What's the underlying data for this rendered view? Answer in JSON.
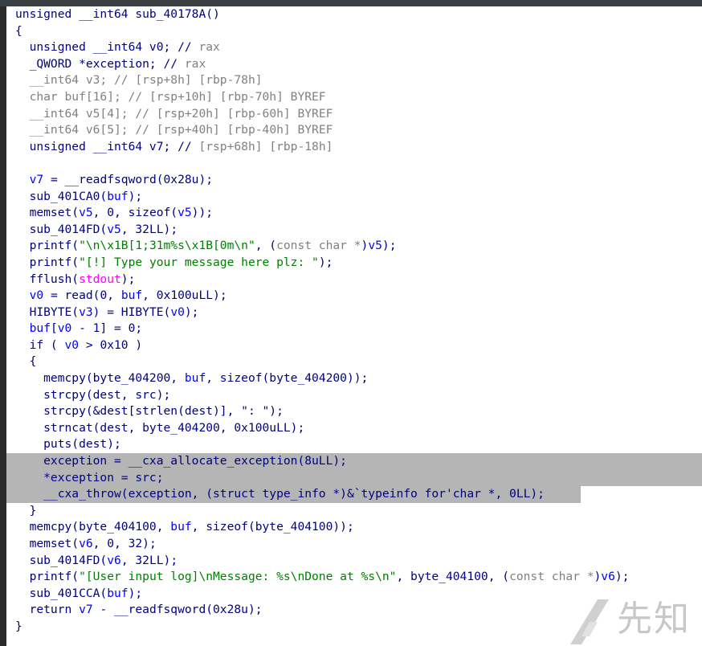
{
  "editor": {
    "lines": [
      {
        "selected": false,
        "tokens": [
          {
            "t": "unsigned __int64 sub_40178A()",
            "c": "plain"
          }
        ]
      },
      {
        "selected": false,
        "tokens": [
          {
            "t": "{",
            "c": "plain"
          }
        ]
      },
      {
        "selected": false,
        "tokens": [
          {
            "t": "  unsigned __int64 v0; // ",
            "c": "plain"
          },
          {
            "t": "rax",
            "c": "cmt"
          }
        ]
      },
      {
        "selected": false,
        "tokens": [
          {
            "t": "  _QWORD *exception; // ",
            "c": "plain"
          },
          {
            "t": "rax",
            "c": "cmt"
          }
        ]
      },
      {
        "selected": false,
        "tokens": [
          {
            "t": "  __int64 v3; // ",
            "c": "cmt"
          },
          {
            "t": "[rsp+8h] [rbp-78h]",
            "c": "cmt"
          }
        ]
      },
      {
        "selected": false,
        "tokens": [
          {
            "t": "  char buf[16]; // ",
            "c": "cmt"
          },
          {
            "t": "[rsp+10h] [rbp-70h] BYREF",
            "c": "cmt"
          }
        ]
      },
      {
        "selected": false,
        "tokens": [
          {
            "t": "  __int64 v5[4]; // ",
            "c": "cmt"
          },
          {
            "t": "[rsp+20h] [rbp-60h] BYREF",
            "c": "cmt"
          }
        ]
      },
      {
        "selected": false,
        "tokens": [
          {
            "t": "  __int64 v6[5]; // ",
            "c": "cmt"
          },
          {
            "t": "[rsp+40h] [rbp-40h] BYREF",
            "c": "cmt"
          }
        ]
      },
      {
        "selected": false,
        "tokens": [
          {
            "t": "  unsigned __int64 v7; // ",
            "c": "plain"
          },
          {
            "t": "[rsp+68h] [rbp-18h]",
            "c": "cmt"
          }
        ]
      },
      {
        "selected": false,
        "tokens": [
          {
            "t": "",
            "c": "plain"
          }
        ]
      },
      {
        "selected": false,
        "tokens": [
          {
            "t": "  v7",
            "c": "var"
          },
          {
            "t": " = __readfsqword(0x28u);",
            "c": "plain"
          }
        ]
      },
      {
        "selected": false,
        "tokens": [
          {
            "t": "  sub_401CA0(",
            "c": "plain"
          },
          {
            "t": "buf",
            "c": "var"
          },
          {
            "t": ");",
            "c": "plain"
          }
        ]
      },
      {
        "selected": false,
        "tokens": [
          {
            "t": "  memset(",
            "c": "plain"
          },
          {
            "t": "v5",
            "c": "var"
          },
          {
            "t": ", 0, sizeof(",
            "c": "plain"
          },
          {
            "t": "v5",
            "c": "var"
          },
          {
            "t": "));",
            "c": "plain"
          }
        ]
      },
      {
        "selected": false,
        "tokens": [
          {
            "t": "  sub_4014FD(",
            "c": "plain"
          },
          {
            "t": "v5",
            "c": "var"
          },
          {
            "t": ", 32LL);",
            "c": "plain"
          }
        ]
      },
      {
        "selected": false,
        "tokens": [
          {
            "t": "  printf(",
            "c": "plain"
          },
          {
            "t": "\"\\n\\x1B[1;31m%s\\x1B[0m\\n\"",
            "c": "str"
          },
          {
            "t": ", (",
            "c": "plain"
          },
          {
            "t": "const char *",
            "c": "cmt"
          },
          {
            "t": ")",
            "c": "plain"
          },
          {
            "t": "v5",
            "c": "var"
          },
          {
            "t": ");",
            "c": "plain"
          }
        ]
      },
      {
        "selected": false,
        "tokens": [
          {
            "t": "  printf(",
            "c": "plain"
          },
          {
            "t": "\"[!] Type your message here plz: \"",
            "c": "str"
          },
          {
            "t": ");",
            "c": "plain"
          }
        ]
      },
      {
        "selected": false,
        "tokens": [
          {
            "t": "  fflush(",
            "c": "plain"
          },
          {
            "t": "stdout",
            "c": "glob"
          },
          {
            "t": ");",
            "c": "plain"
          }
        ]
      },
      {
        "selected": false,
        "tokens": [
          {
            "t": "  v0",
            "c": "var"
          },
          {
            "t": " = read(0, ",
            "c": "plain"
          },
          {
            "t": "buf",
            "c": "var"
          },
          {
            "t": ", 0x100uLL);",
            "c": "plain"
          }
        ]
      },
      {
        "selected": false,
        "tokens": [
          {
            "t": "  HIBYTE(",
            "c": "plain"
          },
          {
            "t": "v3",
            "c": "var"
          },
          {
            "t": ") = HIBYTE(",
            "c": "plain"
          },
          {
            "t": "v0",
            "c": "var"
          },
          {
            "t": ");",
            "c": "plain"
          }
        ]
      },
      {
        "selected": false,
        "tokens": [
          {
            "t": "  buf",
            "c": "var"
          },
          {
            "t": "[",
            "c": "plain"
          },
          {
            "t": "v0",
            "c": "var"
          },
          {
            "t": " - 1] = 0;",
            "c": "plain"
          }
        ]
      },
      {
        "selected": false,
        "tokens": [
          {
            "t": "  if ( ",
            "c": "plain"
          },
          {
            "t": "v0",
            "c": "var"
          },
          {
            "t": " > 0x10 )",
            "c": "plain"
          }
        ]
      },
      {
        "selected": false,
        "tokens": [
          {
            "t": "  {",
            "c": "plain"
          }
        ]
      },
      {
        "selected": false,
        "tokens": [
          {
            "t": "    memcpy(byte_404200, ",
            "c": "plain"
          },
          {
            "t": "buf",
            "c": "var"
          },
          {
            "t": ", sizeof(byte_404200));",
            "c": "plain"
          }
        ]
      },
      {
        "selected": false,
        "tokens": [
          {
            "t": "    strcpy(dest, src);",
            "c": "plain"
          }
        ]
      },
      {
        "selected": false,
        "tokens": [
          {
            "t": "    strcpy(&dest[strlen(dest)], \": \");",
            "c": "plain"
          }
        ]
      },
      {
        "selected": false,
        "tokens": [
          {
            "t": "    strncat(dest, byte_404200, 0x100uLL);",
            "c": "plain"
          }
        ]
      },
      {
        "selected": false,
        "tokens": [
          {
            "t": "    puts(dest);",
            "c": "plain"
          }
        ]
      },
      {
        "selected": "full",
        "tokens": [
          {
            "t": "    exception = __cxa_allocate_exception(8uLL);",
            "c": "plain"
          }
        ]
      },
      {
        "selected": "full",
        "tokens": [
          {
            "t": "    *exception = src;",
            "c": "plain"
          }
        ]
      },
      {
        "selected": "partial",
        "tokens": [
          {
            "t": "    __cxa_throw(exception, (struct type_info *)&`typeinfo for'char *, 0LL);",
            "c": "plain"
          }
        ]
      },
      {
        "selected": false,
        "tokens": [
          {
            "t": "  }",
            "c": "plain"
          }
        ]
      },
      {
        "selected": false,
        "tokens": [
          {
            "t": "  memcpy(byte_404100, ",
            "c": "plain"
          },
          {
            "t": "buf",
            "c": "var"
          },
          {
            "t": ", sizeof(byte_404100));",
            "c": "plain"
          }
        ]
      },
      {
        "selected": false,
        "tokens": [
          {
            "t": "  memset(",
            "c": "plain"
          },
          {
            "t": "v6",
            "c": "var"
          },
          {
            "t": ", 0, 32);",
            "c": "plain"
          }
        ]
      },
      {
        "selected": false,
        "tokens": [
          {
            "t": "  sub_4014FD(",
            "c": "plain"
          },
          {
            "t": "v6",
            "c": "var"
          },
          {
            "t": ", 32LL);",
            "c": "plain"
          }
        ]
      },
      {
        "selected": false,
        "tokens": [
          {
            "t": "  printf(",
            "c": "plain"
          },
          {
            "t": "\"[User input log]\\nMessage: %s\\nDone at %s\\n\"",
            "c": "str"
          },
          {
            "t": ", byte_404100, (",
            "c": "plain"
          },
          {
            "t": "const char *",
            "c": "cmt"
          },
          {
            "t": ")",
            "c": "plain"
          },
          {
            "t": "v6",
            "c": "var"
          },
          {
            "t": ");",
            "c": "plain"
          }
        ]
      },
      {
        "selected": false,
        "tokens": [
          {
            "t": "  sub_401CCA(",
            "c": "plain"
          },
          {
            "t": "buf",
            "c": "var"
          },
          {
            "t": ");",
            "c": "plain"
          }
        ]
      },
      {
        "selected": false,
        "tokens": [
          {
            "t": "  return ",
            "c": "plain"
          },
          {
            "t": "v7",
            "c": "var"
          },
          {
            "t": " - __readfsqword(0x28u);",
            "c": "plain"
          }
        ]
      },
      {
        "selected": false,
        "tokens": [
          {
            "t": "}",
            "c": "plain"
          }
        ]
      }
    ]
  },
  "watermark": {
    "text": "先知",
    "glyph": "slash-logo-icon"
  },
  "colors": {
    "keyword": "#000080",
    "variable": "#0000ff",
    "comment": "#808080",
    "string": "#008000",
    "global": "#ff00ff",
    "selection": "#b5b5b5"
  }
}
